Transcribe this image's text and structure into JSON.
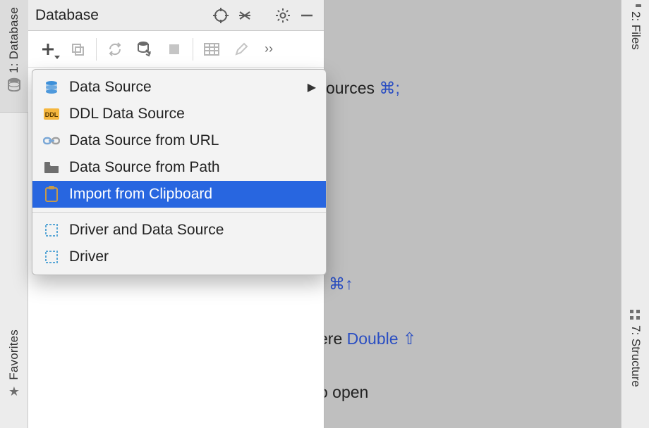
{
  "left_strip": {
    "database_tab": "1: Database",
    "favorites_tab": "Favorites"
  },
  "right_strip": {
    "files_tab": "2: Files",
    "structure_tab": "7: Structure"
  },
  "panel": {
    "title": "Database"
  },
  "menu": {
    "items": [
      {
        "label": "Data Source",
        "submenu": true
      },
      {
        "label": "DDL Data Source"
      },
      {
        "label": "Data Source from URL"
      },
      {
        "label": "Data Source from Path"
      },
      {
        "label": "Import from Clipboard",
        "selected": true
      }
    ],
    "group2": [
      {
        "label": "Driver and Data Source"
      },
      {
        "label": "Driver"
      }
    ]
  },
  "editor": {
    "line1_a": "ources ",
    "line1_b": "⌘;",
    "line2_sym": "⌘↑",
    "line3_a": "ere ",
    "line3_b": "Double ⇧",
    "line4": "o open"
  }
}
